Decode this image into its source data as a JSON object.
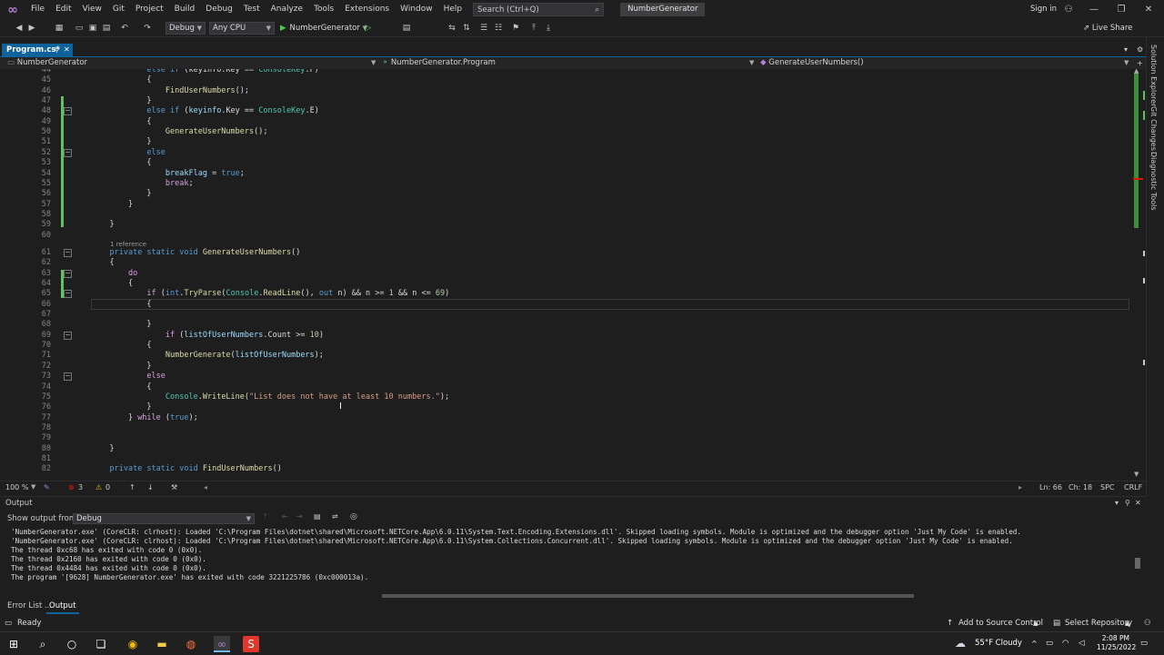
{
  "menu": [
    "File",
    "Edit",
    "View",
    "Git",
    "Project",
    "Build",
    "Debug",
    "Test",
    "Analyze",
    "Tools",
    "Extensions",
    "Window",
    "Help"
  ],
  "search_placeholder": "Search (Ctrl+Q)",
  "project_badge": "NumberGenerator",
  "sign_in": "Sign in",
  "toolbar": {
    "config": "Debug",
    "platform": "Any CPU",
    "run_target": "NumberGenerator",
    "live_share": "Live Share"
  },
  "tab": {
    "name": "Program.cs*"
  },
  "nav": {
    "project": "NumberGenerator",
    "class": "NumberGenerator.Program",
    "member": "GenerateUserNumbers()"
  },
  "code_lines": [
    {
      "n": "44",
      "t": [
        [
          "",
          "            "
        ],
        [
          "kw",
          "else if"
        ],
        [
          "",
          " (keyinfo.Key == "
        ],
        [
          "ty",
          "ConsoleKey"
        ],
        [
          "",
          ".F)"
        ]
      ]
    },
    {
      "n": "45",
      "t": [
        [
          "",
          "            {"
        ]
      ]
    },
    {
      "n": "46",
      "t": [
        [
          "",
          "                "
        ],
        [
          "fn",
          "FindUserNumbers"
        ],
        [
          "",
          "();"
        ]
      ]
    },
    {
      "n": "47",
      "t": [
        [
          "",
          "            }"
        ]
      ]
    },
    {
      "n": "48",
      "t": [
        [
          "",
          "            "
        ],
        [
          "kw",
          "else if"
        ],
        [
          "",
          " ("
        ],
        [
          "vr",
          "keyinfo"
        ],
        [
          "",
          ".Key == "
        ],
        [
          "ty",
          "ConsoleKey"
        ],
        [
          "",
          ".E)"
        ]
      ]
    },
    {
      "n": "49",
      "t": [
        [
          "",
          "            {"
        ]
      ]
    },
    {
      "n": "50",
      "t": [
        [
          "",
          "                "
        ],
        [
          "fn",
          "GenerateUserNumbers"
        ],
        [
          "",
          "();"
        ]
      ]
    },
    {
      "n": "51",
      "t": [
        [
          "",
          "            }"
        ]
      ]
    },
    {
      "n": "52",
      "t": [
        [
          "",
          "            "
        ],
        [
          "kw",
          "else"
        ]
      ]
    },
    {
      "n": "53",
      "t": [
        [
          "",
          "            {"
        ]
      ]
    },
    {
      "n": "54",
      "t": [
        [
          "",
          "                "
        ],
        [
          "vr",
          "breakFlag"
        ],
        [
          "",
          " = "
        ],
        [
          "kw",
          "true"
        ],
        [
          "",
          ";"
        ]
      ]
    },
    {
      "n": "55",
      "t": [
        [
          "",
          "                "
        ],
        [
          "ctl",
          "break"
        ],
        [
          "",
          ";"
        ]
      ]
    },
    {
      "n": "56",
      "t": [
        [
          "",
          "            }"
        ]
      ]
    },
    {
      "n": "57",
      "t": [
        [
          "",
          "        }"
        ]
      ]
    },
    {
      "n": "58",
      "t": [
        [
          "",
          ""
        ]
      ]
    },
    {
      "n": "59",
      "t": [
        [
          "",
          "    }"
        ]
      ]
    },
    {
      "n": "60",
      "t": [
        [
          "",
          ""
        ]
      ]
    },
    {
      "n": "61",
      "t": [
        [
          "",
          "    "
        ],
        [
          "kw",
          "private static void"
        ],
        [
          "",
          " "
        ],
        [
          "fn",
          "GenerateUserNumbers"
        ],
        [
          "",
          "()"
        ]
      ]
    },
    {
      "n": "62",
      "t": [
        [
          "",
          "    {"
        ]
      ]
    },
    {
      "n": "63",
      "t": [
        [
          "",
          "        "
        ],
        [
          "ctl",
          "do"
        ]
      ]
    },
    {
      "n": "64",
      "t": [
        [
          "",
          "        {"
        ]
      ]
    },
    {
      "n": "65",
      "t": [
        [
          "",
          "            "
        ],
        [
          "ctl",
          "if"
        ],
        [
          "",
          " ("
        ],
        [
          "kw",
          "int"
        ],
        [
          "",
          "."
        ],
        [
          "fn",
          "TryParse"
        ],
        [
          "",
          "("
        ],
        [
          "ty",
          "Console"
        ],
        [
          "",
          "."
        ],
        [
          "fn",
          "ReadLine"
        ],
        [
          "",
          "(), "
        ],
        [
          "kw",
          "out"
        ],
        [
          "",
          " n) && n >= "
        ],
        [
          "num",
          "1"
        ],
        [
          "",
          " && n <= "
        ],
        [
          "num",
          "69"
        ],
        [
          "",
          ")"
        ]
      ]
    },
    {
      "n": "66",
      "t": [
        [
          "",
          "            {"
        ]
      ]
    },
    {
      "n": "67",
      "t": [
        [
          "",
          ""
        ]
      ]
    },
    {
      "n": "68",
      "t": [
        [
          "",
          "            }"
        ]
      ]
    },
    {
      "n": "69",
      "t": [
        [
          "",
          "                "
        ],
        [
          "ctl",
          "if"
        ],
        [
          "",
          " ("
        ],
        [
          "vr",
          "listOfUserNumbers"
        ],
        [
          "",
          ".Count >= "
        ],
        [
          "num",
          "10"
        ],
        [
          "",
          ")"
        ]
      ]
    },
    {
      "n": "70",
      "t": [
        [
          "",
          "            {"
        ]
      ]
    },
    {
      "n": "71",
      "t": [
        [
          "",
          "                "
        ],
        [
          "fn",
          "NumberGenerate"
        ],
        [
          "",
          "("
        ],
        [
          "vr",
          "listOfUserNumbers"
        ],
        [
          "",
          ");"
        ]
      ]
    },
    {
      "n": "72",
      "t": [
        [
          "",
          "            }"
        ]
      ]
    },
    {
      "n": "73",
      "t": [
        [
          "",
          "            "
        ],
        [
          "ctl",
          "else"
        ]
      ]
    },
    {
      "n": "74",
      "t": [
        [
          "",
          "            {"
        ]
      ]
    },
    {
      "n": "75",
      "t": [
        [
          "",
          "                "
        ],
        [
          "ty",
          "Console"
        ],
        [
          "",
          "."
        ],
        [
          "fn",
          "WriteLine"
        ],
        [
          "",
          "("
        ],
        [
          "str",
          "\"List does not have at least 10 numbers.\""
        ],
        [
          "",
          ");"
        ]
      ]
    },
    {
      "n": "76",
      "t": [
        [
          "",
          "            }"
        ]
      ]
    },
    {
      "n": "77",
      "t": [
        [
          "",
          "        } "
        ],
        [
          "ctl",
          "while"
        ],
        [
          "",
          " ("
        ],
        [
          "kw",
          "true"
        ],
        [
          "",
          ");"
        ]
      ]
    },
    {
      "n": "78",
      "t": [
        [
          "",
          ""
        ]
      ]
    },
    {
      "n": "79",
      "t": [
        [
          "",
          ""
        ]
      ]
    },
    {
      "n": "80",
      "t": [
        [
          "",
          "    }"
        ]
      ]
    },
    {
      "n": "81",
      "t": [
        [
          "",
          ""
        ]
      ]
    },
    {
      "n": "82",
      "t": [
        [
          "",
          "    "
        ],
        [
          "kw",
          "private static void"
        ],
        [
          "",
          " "
        ],
        [
          "fn",
          "FindUserNumbers"
        ],
        [
          "",
          "()"
        ]
      ]
    }
  ],
  "codelens": "1 reference",
  "editor_status": {
    "zoom": "100 %",
    "errors": "3",
    "warnings": "0",
    "ln": "Ln: 66",
    "ch": "Ch: 18",
    "spc": "SPC",
    "crlf": "CRLF"
  },
  "rail": [
    "Solution Explorer",
    "Git Changes",
    "Diagnostic Tools"
  ],
  "output": {
    "title": "Output",
    "show_label": "Show output from:",
    "source": "Debug",
    "lines": [
      "'NumberGenerator.exe' (CoreCLR: clrhost): Loaded 'C:\\Program Files\\dotnet\\shared\\Microsoft.NETCore.App\\6.0.11\\System.Text.Encoding.Extensions.dll'. Skipped loading symbols. Module is optimized and the debugger option 'Just My Code' is enabled.",
      "'NumberGenerator.exe' (CoreCLR: clrhost): Loaded 'C:\\Program Files\\dotnet\\shared\\Microsoft.NETCore.App\\6.0.11\\System.Collections.Concurrent.dll'. Skipped loading symbols. Module is optimized and the debugger option 'Just My Code' is enabled.",
      "The thread 0xc68 has exited with code 0 (0x0).",
      "The thread 0x2160 has exited with code 0 (0x0).",
      "The thread 0x4484 has exited with code 0 (0x0).",
      "The program '[9628] NumberGenerator.exe' has exited with code 3221225786 (0xc000013a)."
    ]
  },
  "bottom_tabs": [
    "Error List ...",
    "Output"
  ],
  "status": {
    "ready": "Ready",
    "source_control": "Add to Source Control",
    "repo": "Select Repository"
  },
  "taskbar": {
    "weather": "55°F  Cloudy",
    "time": "2:08 PM",
    "date": "11/25/2022"
  }
}
